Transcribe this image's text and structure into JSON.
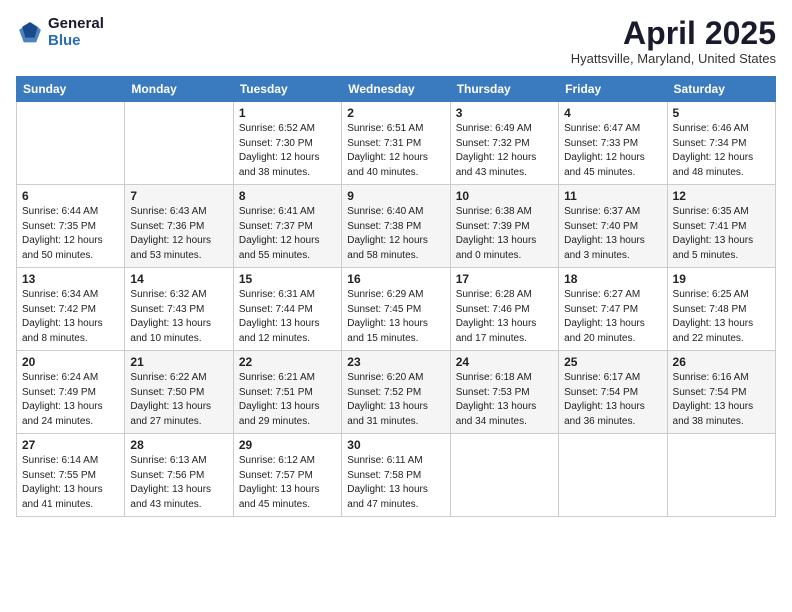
{
  "header": {
    "logo_general": "General",
    "logo_blue": "Blue",
    "month_year": "April 2025",
    "location": "Hyattsville, Maryland, United States"
  },
  "days_of_week": [
    "Sunday",
    "Monday",
    "Tuesday",
    "Wednesday",
    "Thursday",
    "Friday",
    "Saturday"
  ],
  "weeks": [
    [
      {
        "day": "",
        "info": ""
      },
      {
        "day": "",
        "info": ""
      },
      {
        "day": "1",
        "info": "Sunrise: 6:52 AM\nSunset: 7:30 PM\nDaylight: 12 hours\nand 38 minutes."
      },
      {
        "day": "2",
        "info": "Sunrise: 6:51 AM\nSunset: 7:31 PM\nDaylight: 12 hours\nand 40 minutes."
      },
      {
        "day": "3",
        "info": "Sunrise: 6:49 AM\nSunset: 7:32 PM\nDaylight: 12 hours\nand 43 minutes."
      },
      {
        "day": "4",
        "info": "Sunrise: 6:47 AM\nSunset: 7:33 PM\nDaylight: 12 hours\nand 45 minutes."
      },
      {
        "day": "5",
        "info": "Sunrise: 6:46 AM\nSunset: 7:34 PM\nDaylight: 12 hours\nand 48 minutes."
      }
    ],
    [
      {
        "day": "6",
        "info": "Sunrise: 6:44 AM\nSunset: 7:35 PM\nDaylight: 12 hours\nand 50 minutes."
      },
      {
        "day": "7",
        "info": "Sunrise: 6:43 AM\nSunset: 7:36 PM\nDaylight: 12 hours\nand 53 minutes."
      },
      {
        "day": "8",
        "info": "Sunrise: 6:41 AM\nSunset: 7:37 PM\nDaylight: 12 hours\nand 55 minutes."
      },
      {
        "day": "9",
        "info": "Sunrise: 6:40 AM\nSunset: 7:38 PM\nDaylight: 12 hours\nand 58 minutes."
      },
      {
        "day": "10",
        "info": "Sunrise: 6:38 AM\nSunset: 7:39 PM\nDaylight: 13 hours\nand 0 minutes."
      },
      {
        "day": "11",
        "info": "Sunrise: 6:37 AM\nSunset: 7:40 PM\nDaylight: 13 hours\nand 3 minutes."
      },
      {
        "day": "12",
        "info": "Sunrise: 6:35 AM\nSunset: 7:41 PM\nDaylight: 13 hours\nand 5 minutes."
      }
    ],
    [
      {
        "day": "13",
        "info": "Sunrise: 6:34 AM\nSunset: 7:42 PM\nDaylight: 13 hours\nand 8 minutes."
      },
      {
        "day": "14",
        "info": "Sunrise: 6:32 AM\nSunset: 7:43 PM\nDaylight: 13 hours\nand 10 minutes."
      },
      {
        "day": "15",
        "info": "Sunrise: 6:31 AM\nSunset: 7:44 PM\nDaylight: 13 hours\nand 12 minutes."
      },
      {
        "day": "16",
        "info": "Sunrise: 6:29 AM\nSunset: 7:45 PM\nDaylight: 13 hours\nand 15 minutes."
      },
      {
        "day": "17",
        "info": "Sunrise: 6:28 AM\nSunset: 7:46 PM\nDaylight: 13 hours\nand 17 minutes."
      },
      {
        "day": "18",
        "info": "Sunrise: 6:27 AM\nSunset: 7:47 PM\nDaylight: 13 hours\nand 20 minutes."
      },
      {
        "day": "19",
        "info": "Sunrise: 6:25 AM\nSunset: 7:48 PM\nDaylight: 13 hours\nand 22 minutes."
      }
    ],
    [
      {
        "day": "20",
        "info": "Sunrise: 6:24 AM\nSunset: 7:49 PM\nDaylight: 13 hours\nand 24 minutes."
      },
      {
        "day": "21",
        "info": "Sunrise: 6:22 AM\nSunset: 7:50 PM\nDaylight: 13 hours\nand 27 minutes."
      },
      {
        "day": "22",
        "info": "Sunrise: 6:21 AM\nSunset: 7:51 PM\nDaylight: 13 hours\nand 29 minutes."
      },
      {
        "day": "23",
        "info": "Sunrise: 6:20 AM\nSunset: 7:52 PM\nDaylight: 13 hours\nand 31 minutes."
      },
      {
        "day": "24",
        "info": "Sunrise: 6:18 AM\nSunset: 7:53 PM\nDaylight: 13 hours\nand 34 minutes."
      },
      {
        "day": "25",
        "info": "Sunrise: 6:17 AM\nSunset: 7:54 PM\nDaylight: 13 hours\nand 36 minutes."
      },
      {
        "day": "26",
        "info": "Sunrise: 6:16 AM\nSunset: 7:54 PM\nDaylight: 13 hours\nand 38 minutes."
      }
    ],
    [
      {
        "day": "27",
        "info": "Sunrise: 6:14 AM\nSunset: 7:55 PM\nDaylight: 13 hours\nand 41 minutes."
      },
      {
        "day": "28",
        "info": "Sunrise: 6:13 AM\nSunset: 7:56 PM\nDaylight: 13 hours\nand 43 minutes."
      },
      {
        "day": "29",
        "info": "Sunrise: 6:12 AM\nSunset: 7:57 PM\nDaylight: 13 hours\nand 45 minutes."
      },
      {
        "day": "30",
        "info": "Sunrise: 6:11 AM\nSunset: 7:58 PM\nDaylight: 13 hours\nand 47 minutes."
      },
      {
        "day": "",
        "info": ""
      },
      {
        "day": "",
        "info": ""
      },
      {
        "day": "",
        "info": ""
      }
    ]
  ]
}
